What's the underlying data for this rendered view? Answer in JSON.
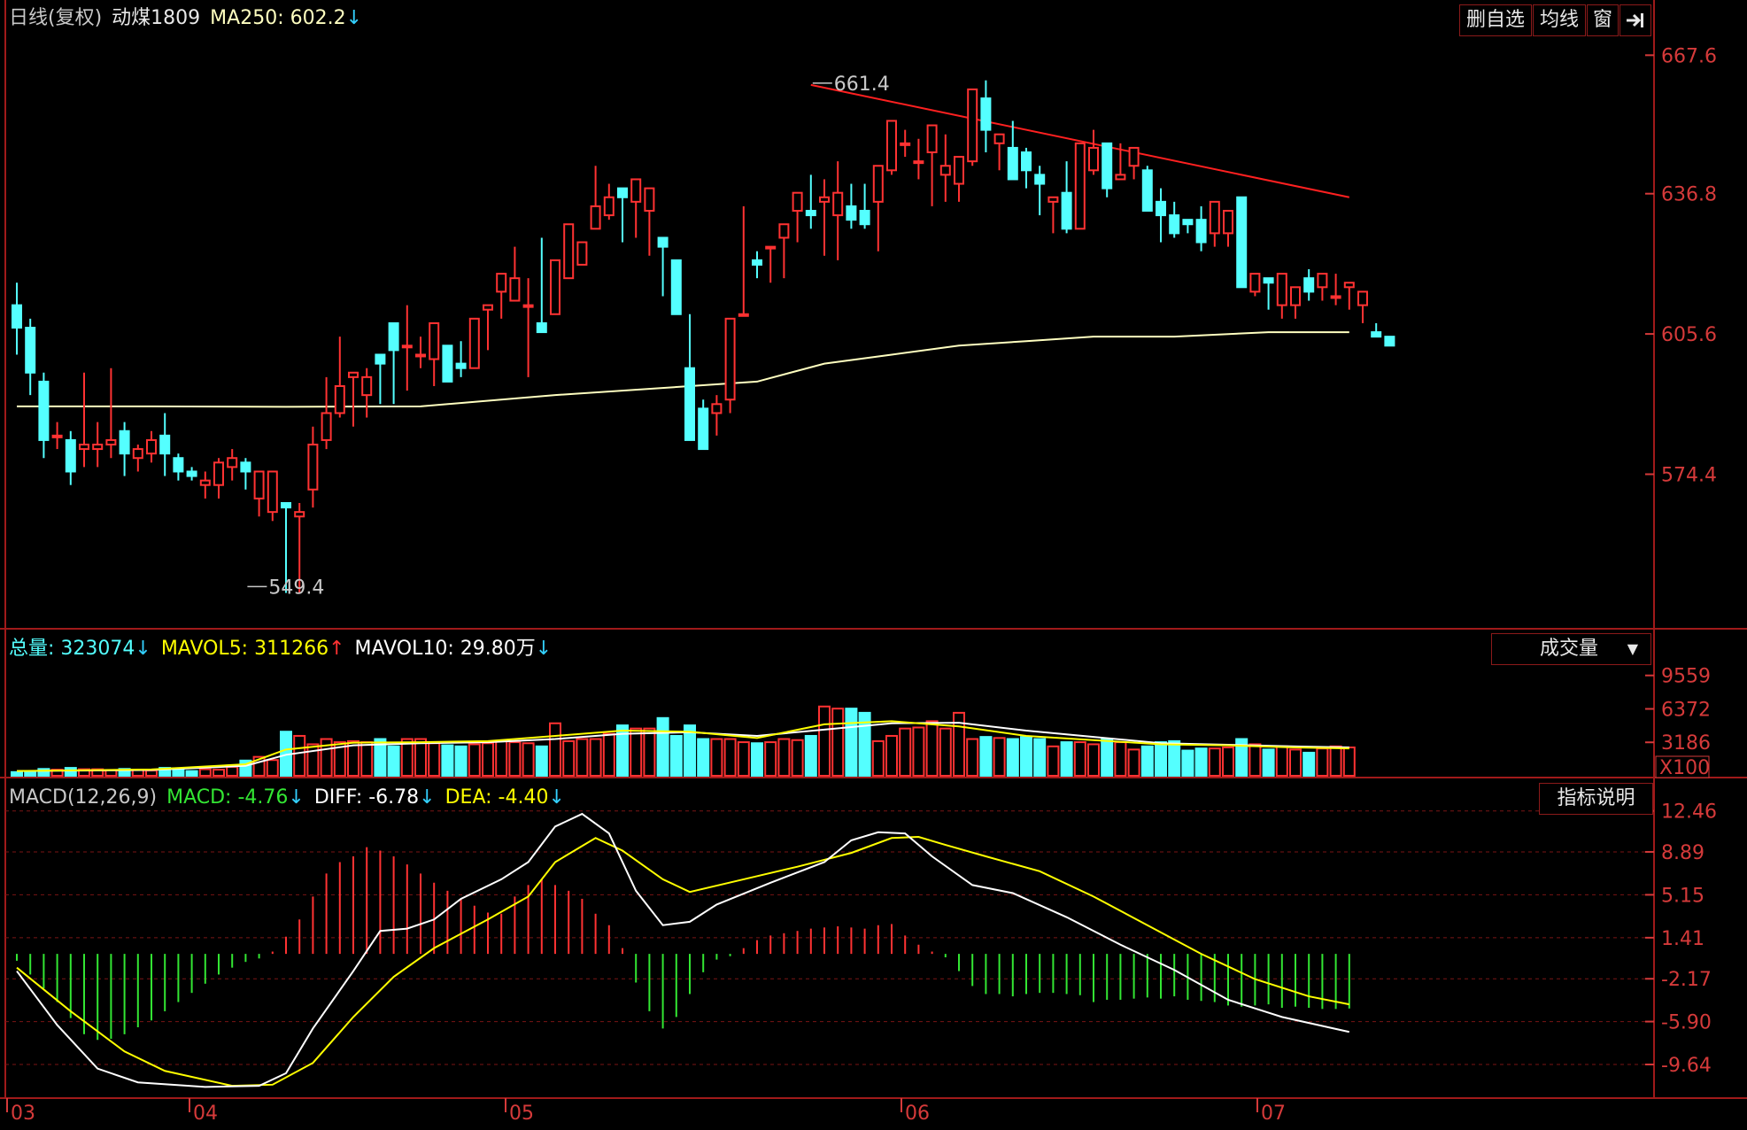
{
  "header": {
    "period": "日线(复权)",
    "symbol": "动煤1809",
    "ma_label": "MA250: 602.2",
    "ma_arrow": "↓"
  },
  "toolbar": {
    "delete_favorite": "删自选",
    "ma_line": "均线",
    "window": "窗",
    "exit_icon": "exit-panel-icon"
  },
  "volume_header": {
    "total_label": "总量: 323074",
    "total_arrow": "↓",
    "mavol5_label": "MAVOL5: 311266",
    "mavol5_arrow": "↑",
    "mavol10_label": "MAVOL10: 29.80万",
    "mavol10_arrow": "↓",
    "indicator_select": "成交量"
  },
  "macd_header": {
    "params": "MACD(12,26,9)",
    "macd_label": "MACD: -4.76",
    "macd_arrow": "↓",
    "diff_label": "DIFF: -6.78",
    "diff_arrow": "↓",
    "dea_label": "DEA: -4.40",
    "dea_arrow": "↓",
    "help_button": "指标说明"
  },
  "colors": {
    "up": "#ff3232",
    "down": "#54ffff",
    "ma250": "#ffffc0",
    "mavol5": "#ffff00",
    "mavol10": "#ffffff",
    "dif": "#ffffff",
    "dea": "#ffff00",
    "axis": "#a01a1a",
    "trendline": "#ff2020"
  },
  "chart_data": [
    {
      "type": "candlestick",
      "y_ticks": [
        "667.6",
        "636.8",
        "605.6",
        "574.4"
      ],
      "ylim": [
        542,
        672
      ],
      "x_ticks": [
        "03",
        "04",
        "05",
        "06",
        "07"
      ],
      "annotations": [
        {
          "text": "661.4",
          "index": 59
        },
        {
          "text": "549.4",
          "index": 17
        }
      ],
      "ohlc": [
        [
          612,
          617,
          601,
          607
        ],
        [
          607,
          609,
          592,
          597
        ],
        [
          595,
          597,
          578,
          582
        ],
        [
          583,
          586,
          580,
          583
        ],
        [
          582,
          584,
          572,
          575
        ],
        [
          580,
          597,
          576,
          581
        ],
        [
          580,
          586,
          576,
          581
        ],
        [
          581,
          598,
          578,
          582
        ],
        [
          584,
          586,
          574,
          579
        ],
        [
          578,
          581,
          575,
          580
        ],
        [
          579,
          584,
          577,
          582
        ],
        [
          583,
          588,
          574,
          579
        ],
        [
          578,
          579,
          573,
          575
        ],
        [
          575,
          576,
          573,
          574
        ],
        [
          572,
          575,
          569,
          573
        ],
        [
          572,
          578,
          569,
          577
        ],
        [
          576,
          580,
          573,
          578
        ],
        [
          577,
          578,
          571,
          575
        ],
        [
          569,
          573,
          565,
          575
        ],
        [
          566,
          575,
          564,
          575
        ],
        [
          568,
          567,
          548,
          567
        ],
        [
          565,
          568,
          548,
          566
        ],
        [
          571,
          585,
          567,
          581
        ],
        [
          582,
          596,
          580,
          588
        ],
        [
          588,
          605,
          587,
          594
        ],
        [
          596,
          596,
          585,
          597
        ],
        [
          592,
          598,
          587,
          596
        ],
        [
          601,
          597,
          590,
          599
        ],
        [
          608,
          605,
          590,
          602
        ],
        [
          603,
          612,
          593,
          603
        ],
        [
          601,
          605,
          598,
          601
        ],
        [
          600,
          599,
          594,
          608
        ],
        [
          603,
          600,
          596,
          595
        ],
        [
          599,
          604,
          596,
          598
        ],
        [
          598,
          609,
          602,
          609
        ],
        [
          611,
          609,
          602,
          612
        ],
        [
          615,
          617,
          609,
          619
        ],
        [
          613,
          625,
          617,
          618
        ],
        [
          612,
          618,
          596,
          612
        ],
        [
          608,
          627,
          615,
          606
        ],
        [
          610,
          614,
          622,
          622
        ],
        [
          618,
          626,
          620,
          630
        ],
        [
          621,
          625,
          628,
          626
        ],
        [
          629,
          643,
          635,
          634
        ],
        [
          632,
          639,
          631,
          636
        ],
        [
          638,
          634,
          626,
          636
        ],
        [
          635,
          636,
          627,
          640
        ],
        [
          633,
          634,
          623,
          638
        ],
        [
          627,
          625,
          614,
          625
        ],
        [
          622,
          620,
          612,
          610
        ],
        [
          598,
          610,
          613,
          582
        ],
        [
          589,
          591,
          586,
          580
        ],
        [
          588,
          592,
          583,
          590
        ],
        [
          591,
          609,
          588,
          609
        ],
        [
          610,
          634,
          620,
          610
        ],
        [
          622,
          624,
          618,
          621
        ],
        [
          625,
          624,
          617,
          625
        ],
        [
          627,
          629,
          618,
          630
        ],
        [
          633,
          633,
          626,
          637
        ],
        [
          633,
          641,
          629,
          632
        ],
        [
          635,
          640,
          623,
          636
        ],
        [
          632,
          644,
          622,
          637
        ],
        [
          634,
          639,
          629,
          631
        ],
        [
          633,
          639,
          629,
          630
        ],
        [
          635,
          638,
          624,
          643
        ],
        [
          642,
          646,
          641,
          653
        ],
        [
          648,
          651,
          645,
          648
        ],
        [
          644,
          649,
          640,
          644
        ],
        [
          646,
          650,
          634,
          652
        ],
        [
          641,
          650,
          635,
          643
        ],
        [
          639,
          644,
          635,
          645
        ],
        [
          644,
          660,
          643,
          660
        ],
        [
          658,
          662,
          646,
          651
        ],
        [
          648,
          646,
          642,
          650
        ],
        [
          647,
          653,
          640,
          640
        ],
        [
          646,
          647,
          638,
          642
        ],
        [
          641,
          643,
          632,
          639
        ],
        [
          635,
          635,
          628,
          636
        ],
        [
          637,
          644,
          628,
          629
        ],
        [
          629,
          642,
          634,
          648
        ],
        [
          642,
          651,
          641,
          647
        ],
        [
          648,
          644,
          636,
          638
        ],
        [
          640,
          648,
          641,
          641
        ],
        [
          643,
          647,
          640,
          647
        ],
        [
          642,
          643,
          634,
          633
        ],
        [
          635,
          638,
          626,
          632
        ],
        [
          632,
          635,
          627,
          628
        ],
        [
          631,
          627,
          628,
          630
        ],
        [
          631,
          634,
          624,
          626
        ],
        [
          628,
          623,
          625,
          635
        ],
        [
          628,
          633,
          625,
          633
        ],
        [
          636,
          628,
          618,
          616
        ],
        [
          615,
          615,
          614,
          619
        ],
        [
          618,
          618,
          611,
          617
        ],
        [
          612,
          614,
          609,
          619
        ],
        [
          612,
          612,
          609,
          616
        ],
        [
          618,
          620,
          613,
          615
        ],
        [
          616,
          612,
          613,
          619
        ],
        [
          614,
          619,
          612,
          614
        ],
        [
          616,
          617,
          611,
          617
        ],
        [
          612,
          614,
          608,
          615
        ],
        [
          606,
          608,
          605,
          605
        ],
        [
          605,
          604,
          607,
          603
        ]
      ],
      "ma250": [
        [
          0,
          589.5
        ],
        [
          10,
          589.5
        ],
        [
          20,
          589.4
        ],
        [
          30,
          589.5
        ],
        [
          40,
          592
        ],
        [
          50,
          594
        ],
        [
          55,
          595
        ],
        [
          60,
          599
        ],
        [
          65,
          601
        ],
        [
          70,
          603
        ],
        [
          75,
          604
        ],
        [
          80,
          605
        ],
        [
          86,
          605
        ],
        [
          93,
          606
        ],
        [
          99,
          606
        ]
      ],
      "trendline": {
        "from": [
          59,
          661
        ],
        "to": [
          99,
          636
        ]
      }
    },
    {
      "type": "bar",
      "name": "volume",
      "unit": "X100",
      "y_ticks": [
        "9559",
        "6372",
        "3186"
      ],
      "ylim": [
        0,
        10800
      ],
      "values": [
        350,
        420,
        650,
        580,
        750,
        620,
        620,
        550,
        650,
        550,
        500,
        750,
        720,
        450,
        620,
        580,
        850,
        1450,
        1800,
        1500,
        4200,
        3800,
        3000,
        3500,
        3200,
        3300,
        3200,
        3500,
        2800,
        3500,
        3500,
        3100,
        2900,
        2800,
        3000,
        3100,
        3300,
        3200,
        3100,
        2800,
        5000,
        3300,
        3500,
        3500,
        4000,
        4800,
        4500,
        4500,
        5500,
        3800,
        4800,
        3500,
        3500,
        3500,
        3200,
        3100,
        3200,
        3500,
        3400,
        3800,
        6600,
        6400,
        6400,
        6000,
        3300,
        3800,
        4500,
        4600,
        5200,
        4500,
        6000,
        3500,
        3700,
        3600,
        3500,
        3700,
        3500,
        2800,
        3200,
        3200,
        3000,
        3500,
        3200,
        2500,
        2800,
        3200,
        3300,
        2400,
        2600,
        2600,
        2700,
        3500,
        3000,
        2500,
        2800,
        2500,
        2200,
        2600,
        2800,
        2700
      ],
      "mavol5": [
        [
          0,
          450
        ],
        [
          10,
          600
        ],
        [
          17,
          1100
        ],
        [
          20,
          2500
        ],
        [
          25,
          3150
        ],
        [
          30,
          3200
        ],
        [
          35,
          3300
        ],
        [
          40,
          3800
        ],
        [
          45,
          4300
        ],
        [
          50,
          4200
        ],
        [
          55,
          3600
        ],
        [
          60,
          4900
        ],
        [
          65,
          5200
        ],
        [
          70,
          4700
        ],
        [
          75,
          3800
        ],
        [
          80,
          3400
        ],
        [
          85,
          3000
        ],
        [
          90,
          2900
        ],
        [
          95,
          2700
        ],
        [
          99,
          2600
        ]
      ],
      "mavol10": [
        [
          0,
          450
        ],
        [
          10,
          550
        ],
        [
          17,
          950
        ],
        [
          20,
          2000
        ],
        [
          25,
          2900
        ],
        [
          30,
          3100
        ],
        [
          35,
          3200
        ],
        [
          40,
          3500
        ],
        [
          45,
          4000
        ],
        [
          50,
          4150
        ],
        [
          55,
          3800
        ],
        [
          60,
          4400
        ],
        [
          65,
          5000
        ],
        [
          70,
          5050
        ],
        [
          75,
          4300
        ],
        [
          80,
          3700
        ],
        [
          85,
          3100
        ],
        [
          90,
          2950
        ],
        [
          95,
          2800
        ],
        [
          99,
          2700
        ]
      ]
    },
    {
      "type": "line",
      "name": "MACD",
      "y_ticks": [
        "12.46",
        "8.89",
        "5.15",
        "1.41",
        "-2.17",
        "-5.90",
        "-9.64"
      ],
      "ylim": [
        -11.8,
        12.9
      ],
      "dif": [
        [
          0,
          -1.5
        ],
        [
          3,
          -6.2
        ],
        [
          6,
          -10.0
        ],
        [
          9,
          -11.2
        ],
        [
          14,
          -11.6
        ],
        [
          18,
          -11.5
        ],
        [
          20,
          -10.4
        ],
        [
          22,
          -6.5
        ],
        [
          25,
          -1.5
        ],
        [
          27,
          2.0
        ],
        [
          29,
          2.2
        ],
        [
          31,
          3.0
        ],
        [
          33,
          4.8
        ],
        [
          36,
          6.5
        ],
        [
          38,
          8.0
        ],
        [
          40,
          11.1
        ],
        [
          42,
          12.2
        ],
        [
          44,
          10.5
        ],
        [
          46,
          5.5
        ],
        [
          48,
          2.5
        ],
        [
          50,
          2.8
        ],
        [
          52,
          4.3
        ],
        [
          56,
          6.2
        ],
        [
          60,
          8.0
        ],
        [
          62,
          9.9
        ],
        [
          64,
          10.6
        ],
        [
          66,
          10.5
        ],
        [
          68,
          8.5
        ],
        [
          71,
          6.0
        ],
        [
          74,
          5.3
        ],
        [
          78,
          3.2
        ],
        [
          82,
          0.8
        ],
        [
          86,
          -1.4
        ],
        [
          90,
          -4.0
        ],
        [
          94,
          -5.5
        ],
        [
          99,
          -6.8
        ]
      ],
      "dea": [
        [
          0,
          -1.2
        ],
        [
          4,
          -5.0
        ],
        [
          8,
          -8.5
        ],
        [
          11,
          -10.2
        ],
        [
          16,
          -11.5
        ],
        [
          19,
          -11.4
        ],
        [
          22,
          -9.5
        ],
        [
          25,
          -5.5
        ],
        [
          28,
          -2.0
        ],
        [
          31,
          0.5
        ],
        [
          35,
          3.0
        ],
        [
          38,
          5.0
        ],
        [
          40,
          8.0
        ],
        [
          43,
          10.1
        ],
        [
          45,
          9.0
        ],
        [
          48,
          6.5
        ],
        [
          50,
          5.4
        ],
        [
          54,
          6.5
        ],
        [
          58,
          7.6
        ],
        [
          62,
          8.8
        ],
        [
          65,
          10.1
        ],
        [
          67,
          10.2
        ],
        [
          69,
          9.5
        ],
        [
          72,
          8.5
        ],
        [
          76,
          7.2
        ],
        [
          80,
          5.0
        ],
        [
          84,
          2.5
        ],
        [
          88,
          0.0
        ],
        [
          92,
          -2.2
        ],
        [
          96,
          -3.7
        ],
        [
          99,
          -4.4
        ]
      ],
      "macd": [
        -0.6,
        -1.8,
        -3.0,
        -4.2,
        -5.6,
        -7.0,
        -7.5,
        -7.4,
        -7.0,
        -6.4,
        -5.8,
        -5.0,
        -4.2,
        -3.4,
        -2.6,
        -1.8,
        -1.2,
        -0.7,
        -0.4,
        0.2,
        1.5,
        3.0,
        5.0,
        7.0,
        8.0,
        8.5,
        9.3,
        9.0,
        8.5,
        7.8,
        7.0,
        6.2,
        5.5,
        4.8,
        4.2,
        3.6,
        3.5,
        5.0,
        6.0,
        6.5,
        6.0,
        5.5,
        4.8,
        3.5,
        2.5,
        0.5,
        -2.5,
        -5.0,
        -6.5,
        -5.5,
        -3.5,
        -1.6,
        -0.5,
        -0.2,
        0.5,
        1.2,
        1.6,
        1.8,
        2.0,
        2.2,
        2.3,
        2.4,
        2.3,
        2.2,
        2.5,
        2.6,
        1.6,
        0.8,
        0.2,
        -0.3,
        -1.5,
        -2.8,
        -3.5,
        -3.5,
        -3.7,
        -3.5,
        -3.4,
        -3.4,
        -3.5,
        -3.6,
        -4.2,
        -4.0,
        -4.0,
        -3.9,
        -3.8,
        -3.9,
        -3.7,
        -4.0,
        -4.1,
        -4.2,
        -4.5,
        -4.6,
        -4.5,
        -4.4,
        -4.7,
        -4.6,
        -4.7,
        -4.8,
        -4.8,
        -4.76
      ]
    }
  ]
}
